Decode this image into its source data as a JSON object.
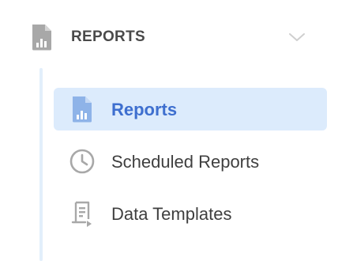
{
  "section": {
    "title": "REPORTS",
    "icon": "report-icon",
    "expanded": true,
    "chevron_icon": "chevron-down-icon"
  },
  "items": [
    {
      "label": "Reports",
      "icon": "report-icon",
      "active": true
    },
    {
      "label": "Scheduled Reports",
      "icon": "clock-icon",
      "active": false
    },
    {
      "label": "Data Templates",
      "icon": "template-icon",
      "active": false
    }
  ],
  "colors": {
    "active_bg": "#dcebfc",
    "active_text": "#3e6fcf",
    "active_icon": "#8eb3e8",
    "text": "#3f3f3f",
    "icon_gray": "#a8a8a8",
    "tree_line": "#e2effb"
  }
}
